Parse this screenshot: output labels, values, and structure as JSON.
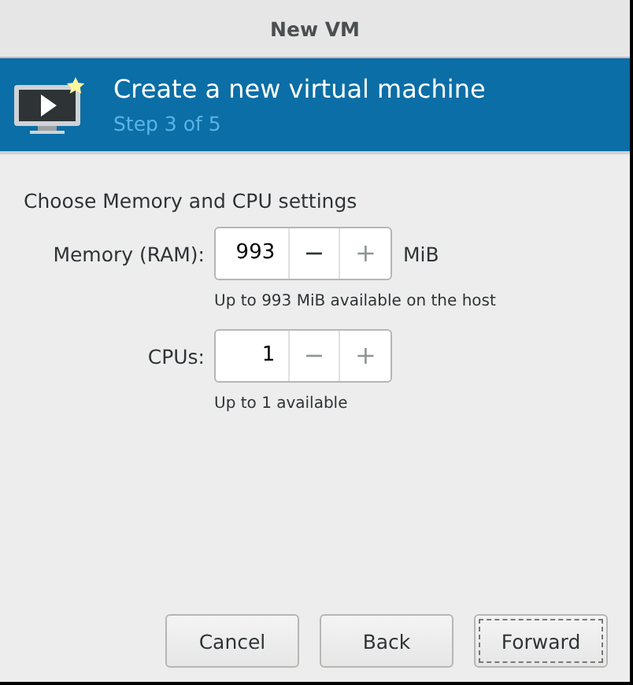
{
  "window": {
    "title": "New VM"
  },
  "header": {
    "title": "Create a new virtual machine",
    "subtitle": "Step 3 of 5"
  },
  "section_title": "Choose Memory and CPU settings",
  "fields": [
    {
      "label": "Memory (RAM):",
      "value": "993",
      "decrement": "−",
      "increment": "+",
      "decrement_disabled": false,
      "increment_disabled": true,
      "unit": "MiB",
      "hint": "Up to 993 MiB available on the host"
    },
    {
      "label": "CPUs:",
      "value": "1",
      "decrement": "−",
      "increment": "+",
      "decrement_disabled": true,
      "increment_disabled": true,
      "hint": "Up to 1 available"
    }
  ],
  "buttons": [
    {
      "label": "Cancel",
      "focused": false
    },
    {
      "label": "Back",
      "focused": false
    },
    {
      "label": "Forward",
      "focused": true
    }
  ]
}
